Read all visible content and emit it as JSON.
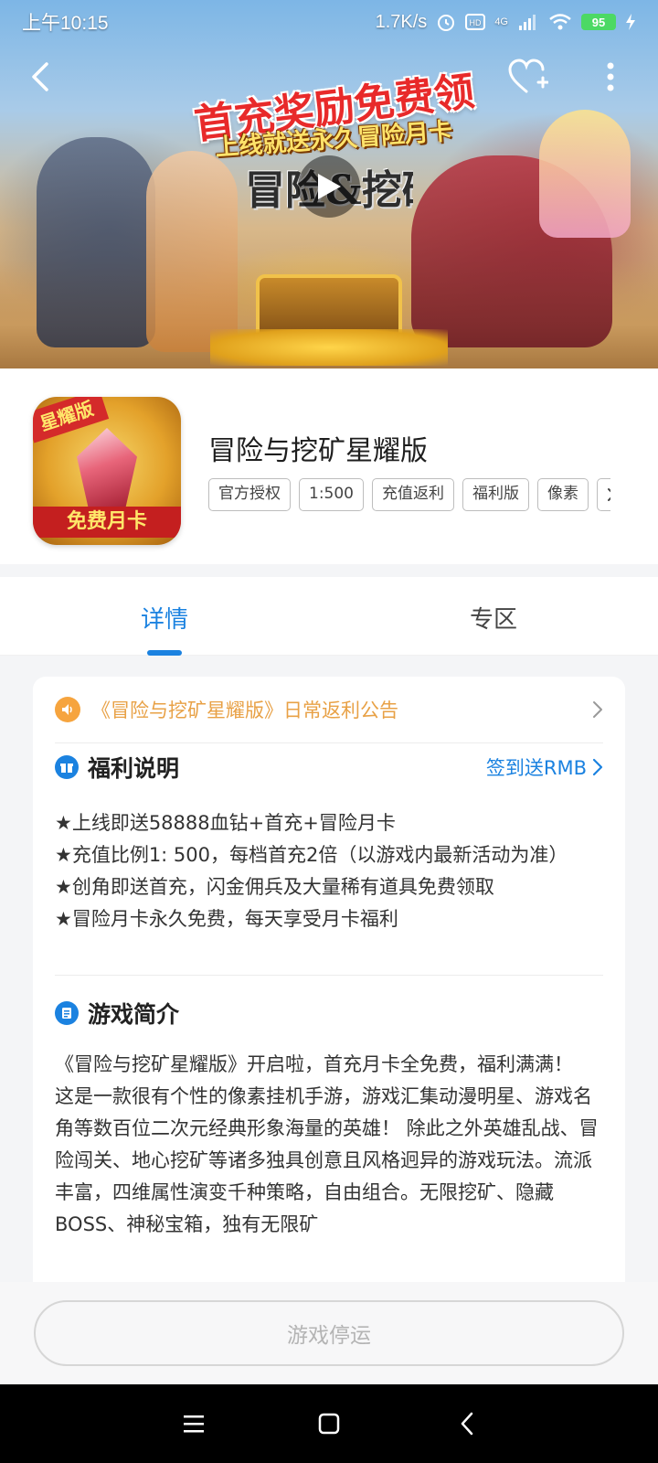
{
  "status_bar": {
    "time": "上午10:15",
    "network_speed": "1.7K/s",
    "signal_label": "4G",
    "battery_level": "95"
  },
  "banner": {
    "promo_title": "首充奖励免费领",
    "promo_subtitle": "上线就送永久冒险月卡",
    "logo_text": "冒险&挖矿"
  },
  "app": {
    "name": "冒险与挖矿星耀版",
    "icon_badge_top": "星耀版",
    "icon_badge_bottom": "免费月卡",
    "tags": [
      "官方授权",
      "1:500",
      "充值返利",
      "福利版",
      "像素"
    ]
  },
  "tabs": {
    "details": "详情",
    "zone": "专区"
  },
  "notice": {
    "text": "《冒险与挖矿星耀版》日常返利公告"
  },
  "benefits": {
    "title": "福利说明",
    "link": "签到送RMB",
    "items": [
      "★上线即送58888血钻+首充+冒险月卡",
      "★充值比例1: 500，每档首充2倍（以游戏内最新活动为准）",
      "★创角即送首充，闪金佣兵及大量稀有道具免费领取",
      "★冒险月卡永久免费，每天享受月卡福利"
    ]
  },
  "intro": {
    "title": "游戏简介",
    "paragraphs": [
      "《冒险与挖矿星耀版》开启啦，首充月卡全免费，福利满满！",
      "这是一款很有个性的像素挂机手游，游戏汇集动漫明星、游戏名角等数百位二次元经典形象海量的英雄！ 除此之外英雄乱战、冒险闯关、地心挖矿等诸多独具创意且风格迥异的游戏玩法。流派丰富，四维属性演变千种策略，自由组合。无限挖矿、隐藏BOSS、神秘宝箱，独有无限矿"
    ]
  },
  "action": {
    "button_label": "游戏停运"
  },
  "colors": {
    "accent": "#1b82e0",
    "notice": "#e8a146",
    "battery": "#4cd964"
  }
}
